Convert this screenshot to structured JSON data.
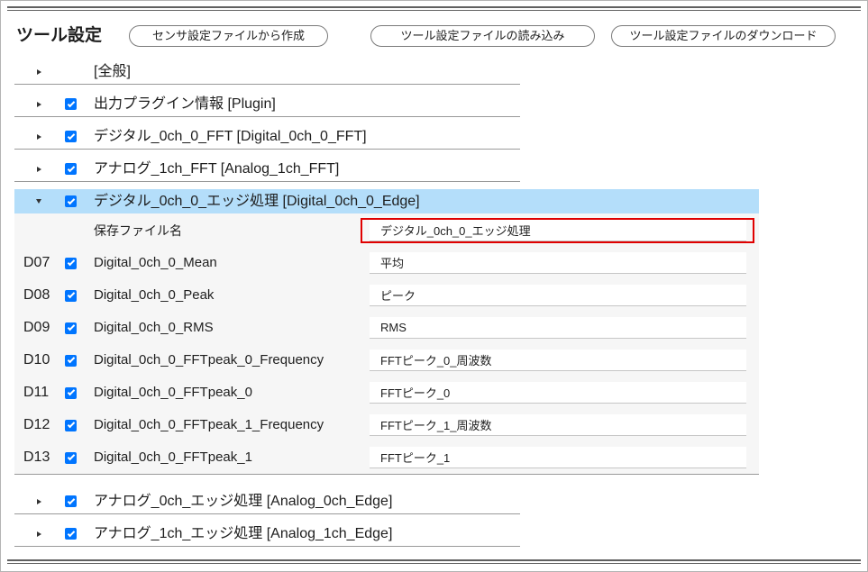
{
  "colors": {
    "accent": "#0075ff",
    "selected_row": "#b4defa",
    "detail_background": "#f6f6f6",
    "annotation": "#e00000",
    "rule": "#999999"
  },
  "icons": {
    "collapsed": "triangle-right-icon",
    "expanded": "triangle-down-icon"
  },
  "header": {
    "title": "ツール設定",
    "buttons": [
      {
        "label": "センサ設定ファイルから作成"
      },
      {
        "label": "ツール設定ファイルの読み込み"
      },
      {
        "label": "ツール設定ファイルのダウンロード"
      }
    ]
  },
  "tree": {
    "items": [
      {
        "label": "[全般]",
        "expanded": false
      },
      {
        "label": "出力プラグイン情報 [Plugin]",
        "checked": true,
        "expanded": false
      },
      {
        "label": "デジタル_0ch_0_FFT [Digital_0ch_0_FFT]",
        "checked": true,
        "expanded": false
      },
      {
        "label": "アナログ_1ch_FFT [Analog_1ch_FFT]",
        "checked": true,
        "expanded": false
      },
      {
        "label": "デジタル_0ch_0_エッジ処理 [Digital_0ch_0_Edge]",
        "checked": true,
        "expanded": true,
        "selected": true,
        "detail": {
          "save_file": {
            "label": "保存ファイル名",
            "value": "デジタル_0ch_0_エッジ処理",
            "highlighted": true
          },
          "channels": [
            {
              "id": "D07",
              "checked": true,
              "name": "Digital_0ch_0_Mean",
              "value": "平均"
            },
            {
              "id": "D08",
              "checked": true,
              "name": "Digital_0ch_0_Peak",
              "value": "ピーク"
            },
            {
              "id": "D09",
              "checked": true,
              "name": "Digital_0ch_0_RMS",
              "value": "RMS"
            },
            {
              "id": "D10",
              "checked": true,
              "name": "Digital_0ch_0_FFTpeak_0_Frequency",
              "value": "FFTピーク_0_周波数"
            },
            {
              "id": "D11",
              "checked": true,
              "name": "Digital_0ch_0_FFTpeak_0",
              "value": "FFTピーク_0"
            },
            {
              "id": "D12",
              "checked": true,
              "name": "Digital_0ch_0_FFTpeak_1_Frequency",
              "value": "FFTピーク_1_周波数"
            },
            {
              "id": "D13",
              "checked": true,
              "name": "Digital_0ch_0_FFTpeak_1",
              "value": "FFTピーク_1"
            }
          ]
        }
      },
      {
        "label": "アナログ_0ch_エッジ処理 [Analog_0ch_Edge]",
        "checked": true,
        "expanded": false
      },
      {
        "label": "アナログ_1ch_エッジ処理 [Analog_1ch_Edge]",
        "checked": true,
        "expanded": false
      }
    ]
  }
}
